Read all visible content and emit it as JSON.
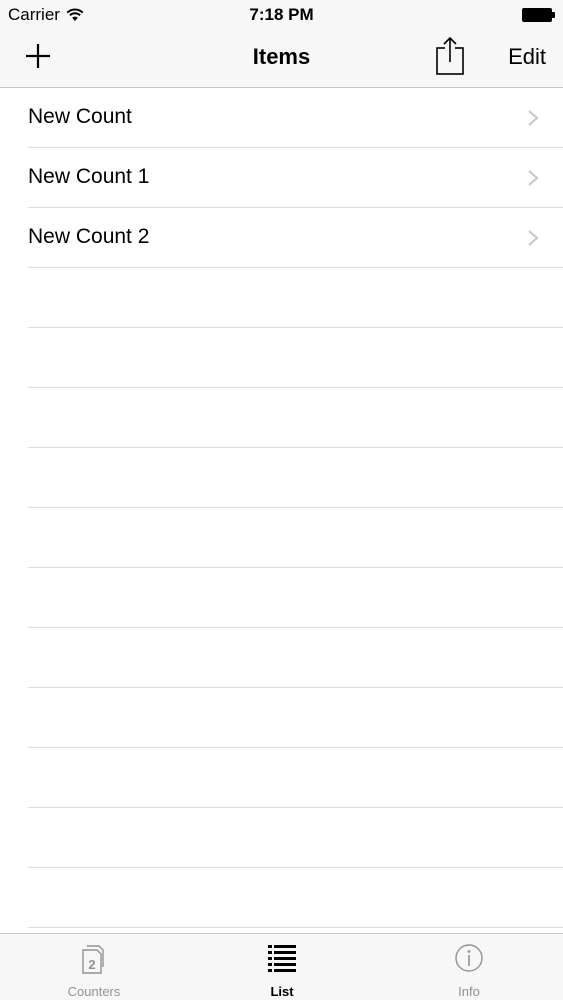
{
  "status_bar": {
    "carrier": "Carrier",
    "time": "7:18 PM"
  },
  "nav_bar": {
    "title": "Items",
    "edit_label": "Edit",
    "add_icon": "plus-icon",
    "share_icon": "share-icon"
  },
  "list": {
    "items": [
      {
        "label": "New Count"
      },
      {
        "label": "New Count 1"
      },
      {
        "label": "New Count 2"
      }
    ]
  },
  "tab_bar": {
    "tabs": [
      {
        "label": "Counters",
        "icon": "counters-icon",
        "active": false
      },
      {
        "label": "List",
        "icon": "list-icon",
        "active": true
      },
      {
        "label": "Info",
        "icon": "info-icon",
        "active": false
      }
    ]
  },
  "colors": {
    "bar_background": "#f7f7f7",
    "separator": "#dcdcdc",
    "chevron": "#c7c7cc",
    "inactive_tab": "#929292",
    "active_tab": "#000000"
  }
}
